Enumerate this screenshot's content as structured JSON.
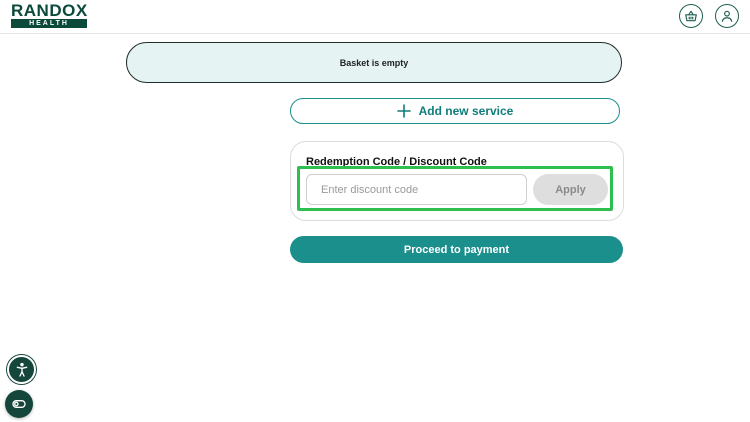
{
  "header": {
    "logo_top": "RANDOX",
    "logo_bottom": "HEALTH",
    "icons": [
      "basket-icon",
      "account-icon"
    ]
  },
  "basket": {
    "empty_message": "Basket is empty"
  },
  "add_service": {
    "label": "Add new service",
    "icon": "plus-icon"
  },
  "discount": {
    "title": "Redemption Code / Discount Code",
    "input_value": "",
    "input_placeholder": "Enter discount code",
    "apply_label": "Apply"
  },
  "checkout": {
    "proceed_label": "Proceed to payment"
  },
  "widgets": {
    "icons": [
      "accessibility-icon",
      "cookie-settings-icon"
    ]
  },
  "colors": {
    "brand_dark": "#0b4a3a",
    "accent_teal": "#1a8f8b",
    "empty_bg": "#e5f4f3",
    "highlight": "#2fbf4f",
    "disabled_bg": "#dedede"
  }
}
